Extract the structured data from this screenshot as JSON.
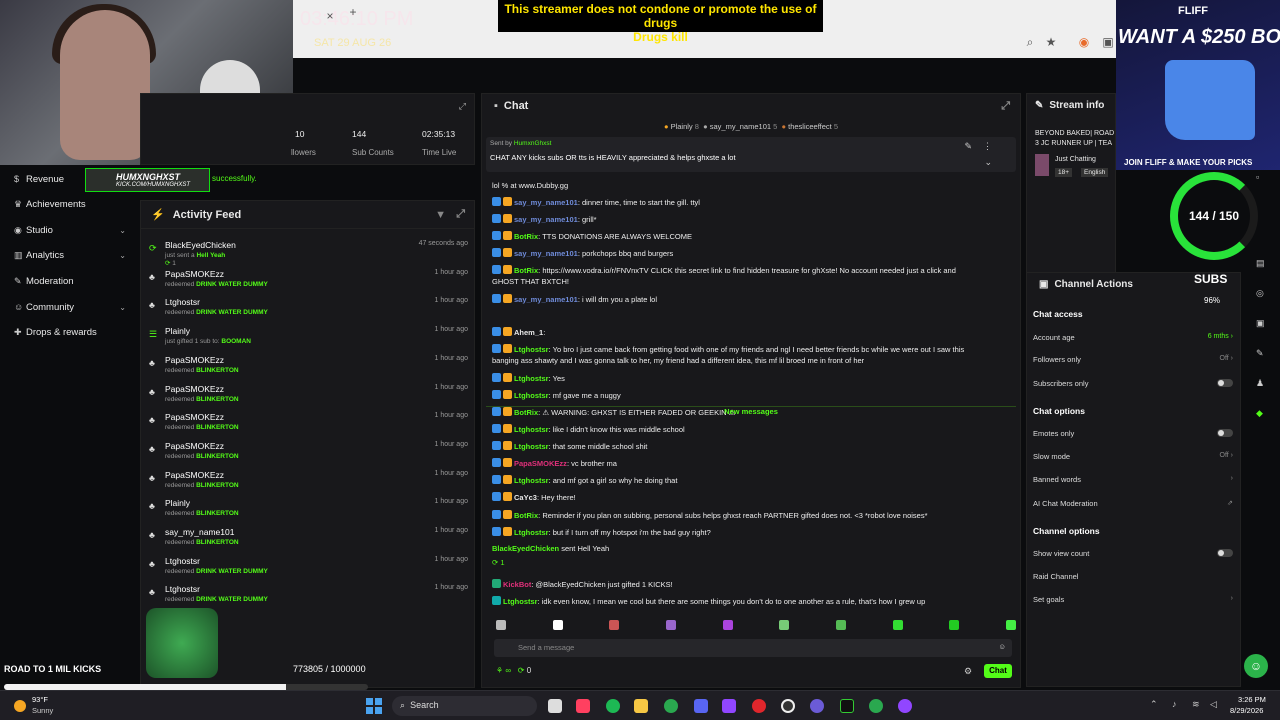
{
  "overlay": {
    "clock": "03:46:10 PM",
    "date": "SAT 29 AUG 26",
    "banner_line1": "This streamer does not condone or promote the use of drugs",
    "banner_line2": "Drugs kill",
    "channel_logo": "HUMXNGHXST",
    "channel_url": "KICK.COM/HUMXNGHXST",
    "toast": "successfully.",
    "goal_label": "ROAD TO 1 MIL KICKS",
    "goal_count": "773805 / 1000000",
    "goal_progress": 0.774,
    "sub_ring": "144 / 150",
    "subs_label": "SUBS",
    "subs_percent": "96%",
    "ad_brand": "FLIFF",
    "ad_line1": "WANT A $250 BON",
    "ad_line2": "JOIN FLIFF & MAKE YOUR PICKS"
  },
  "sidebar": {
    "items": [
      {
        "label": "Revenue",
        "icon": "dollar-icon"
      },
      {
        "label": "Achievements",
        "icon": "trophy-icon"
      },
      {
        "label": "Studio",
        "icon": "camera-icon"
      },
      {
        "label": "Analytics",
        "icon": "chart-icon"
      },
      {
        "label": "Moderation",
        "icon": "wrench-icon"
      },
      {
        "label": "Community",
        "icon": "people-icon"
      },
      {
        "label": "Drops & rewards",
        "icon": "gift-icon"
      }
    ]
  },
  "stats": {
    "followers_value": "10",
    "followers_label": "llowers",
    "subs_value": "144",
    "subs_label": "Sub Counts",
    "time_value": "02:35:13",
    "time_label": "Time Live"
  },
  "feed": {
    "title": "Activity Feed",
    "items": [
      {
        "user": "BlackEyedChicken",
        "action": "just sent a",
        "detail": "Hell Yeah",
        "time": "47 seconds ago",
        "extra": "1"
      },
      {
        "user": "PapaSMOKEzz",
        "action": "redeemed",
        "detail": "DRINK WATER DUMMY",
        "time": "1 hour ago"
      },
      {
        "user": "Ltghostsr",
        "action": "redeemed",
        "detail": "DRINK WATER DUMMY",
        "time": "1 hour ago"
      },
      {
        "user": "Plainly",
        "action": "just gifted 1 sub to:",
        "detail": "BOOMAN",
        "time": "1 hour ago"
      },
      {
        "user": "PapaSMOKEzz",
        "action": "redeemed",
        "detail": "BLINKERTON",
        "time": "1 hour ago"
      },
      {
        "user": "PapaSMOKEzz",
        "action": "redeemed",
        "detail": "BLINKERTON",
        "time": "1 hour ago"
      },
      {
        "user": "PapaSMOKEzz",
        "action": "redeemed",
        "detail": "BLINKERTON",
        "time": "1 hour ago"
      },
      {
        "user": "PapaSMOKEzz",
        "action": "redeemed",
        "detail": "BLINKERTON",
        "time": "1 hour ago"
      },
      {
        "user": "PapaSMOKEzz",
        "action": "redeemed",
        "detail": "BLINKERTON",
        "time": "1 hour ago"
      },
      {
        "user": "Plainly",
        "action": "redeemed",
        "detail": "BLINKERTON",
        "time": "1 hour ago"
      },
      {
        "user": "say_my_name101",
        "action": "redeemed",
        "detail": "BLINKERTON",
        "time": "1 hour ago"
      },
      {
        "user": "Ltghostsr",
        "action": "redeemed",
        "detail": "DRINK WATER DUMMY",
        "time": "1 hour ago"
      },
      {
        "user": "Ltghostsr",
        "action": "redeemed",
        "detail": "DRINK WATER DUMMY",
        "time": "1 hour ago"
      }
    ]
  },
  "chat": {
    "title": "Chat",
    "top_users": [
      "Plainly",
      "8",
      "say_my_name101",
      "5",
      "thesliceeffect",
      "5"
    ],
    "pinned_by_label": "Sent by",
    "pinned_by": "HumxnGhxst",
    "pinned_text": "CHAT ANY kicks subs OR tts is HEAVILY appreciated & helps ghxste a lot",
    "new_messages": "New messages",
    "send_placeholder": "Send a message",
    "chat_button": "Chat",
    "footer_count": "0",
    "messages": [
      {
        "user": "",
        "text": "lol % at www.Dubby.gg",
        "color": "#e8e8e8"
      },
      {
        "user": "say_my_name101",
        "text": ": dinner time, time to start the gill. ttyl",
        "color": "#6f8bd9"
      },
      {
        "user": "say_my_name101",
        "text": ": grill*",
        "color": "#6f8bd9"
      },
      {
        "user": "BotRix",
        "text": ": TTS DONATIONS ARE ALWAYS WELCOME",
        "color": "#53fc18"
      },
      {
        "user": "say_my_name101",
        "text": ": porkchops bbq and burgers",
        "color": "#6f8bd9"
      },
      {
        "user": "BotRix",
        "text": ": https://www.vodra.io/r/FNVnxTV CLICK this secret link to find hidden treasure for ghXste! No account needed just a click and",
        "color": "#53fc18"
      },
      {
        "user": "",
        "text": "GHOST THAT BXTCH!",
        "color": "#e8e8e8"
      },
      {
        "user": "say_my_name101",
        "text": ": i will dm you a plate lol",
        "color": "#6f8bd9"
      },
      {
        "user": "Ahem_1",
        "text": ":",
        "color": "#e8e8e8"
      },
      {
        "user": "Ltghostsr",
        "text": ": Yo bro I just came back from getting food with one of my friends and ngl I need better friends bc while we were out I saw this",
        "color": "#53fc18"
      },
      {
        "user": "",
        "text": "banging ass shawty and I was gonna talk to her, my friend had a different idea, this mf lil broed me in front of her",
        "color": "#e8e8e8"
      },
      {
        "user": "Ltghostsr",
        "text": ": Yes",
        "color": "#53fc18"
      },
      {
        "user": "Ltghostsr",
        "text": ": mf gave me a nuggy",
        "color": "#53fc18"
      },
      {
        "user": "BotRix",
        "text": ": ⚠ WARNING: GHXST IS EITHER FADED OR GEEKIN ⚠",
        "color": "#53fc18"
      },
      {
        "user": "Ltghostsr",
        "text": ": like I didn't know this was middle school",
        "color": "#53fc18"
      },
      {
        "user": "Ltghostsr",
        "text": ": that some middle school shit",
        "color": "#53fc18"
      },
      {
        "user": "PapaSMOKEzz",
        "text": ": vc brother ma",
        "color": "#e0307a"
      },
      {
        "user": "Ltghostsr",
        "text": ": and mf got a girl so why he doing that",
        "color": "#53fc18"
      },
      {
        "user": "CaYc3",
        "text": ": Hey there!",
        "color": "#e8e8e8"
      },
      {
        "user": "BotRix",
        "text": ": Reminder if you plan on subbing, personal subs helps ghxst reach PARTNER gifted does not. <3 *robot love noises*",
        "color": "#53fc18"
      },
      {
        "user": "Ltghostsr",
        "text": ": but if I turn off my hotspot i'm the bad guy right?",
        "color": "#53fc18"
      }
    ],
    "gift_user": "BlackEyedChicken",
    "gift_text": "sent Hell Yeah",
    "gift_count": "1",
    "kick_user": "KickBot",
    "kick_text": ": @BlackEyedChicken just gifted 1 KICKS!",
    "last_user": "Ltghostsr",
    "last_text": ": idk even know, I mean we cool but there are some things you don't do to one another as a rule, that's how I grew up"
  },
  "stream_info": {
    "title": "Stream info",
    "stream_title": "BEYOND BAKED| ROAD",
    "stream_title2": "3 JC RUNNER UP | TEA",
    "category": "Just Chatting",
    "age_badge": "18+",
    "language": "English"
  },
  "channel_actions": {
    "title": "Channel Actions",
    "chat_access_title": "Chat access",
    "account_age_label": "Account age",
    "account_age_value": "6 mths",
    "followers_only_label": "Followers only",
    "followers_only_value": "Off",
    "subscribers_only_label": "Subscribers only",
    "chat_options_title": "Chat options",
    "emotes_only_label": "Emotes only",
    "slow_mode_label": "Slow mode",
    "slow_mode_value": "Off",
    "banned_words_label": "Banned words",
    "ai_mod_label": "AI Chat Moderation",
    "channel_options_title": "Channel options",
    "view_count_label": "Show view count",
    "raid_label": "Raid Channel",
    "goals_label": "Set goals"
  },
  "taskbar": {
    "weather_temp": "93°F",
    "weather_desc": "Sunny",
    "search_label": "Search",
    "time": "3:26 PM",
    "date": "8/29/2026"
  }
}
